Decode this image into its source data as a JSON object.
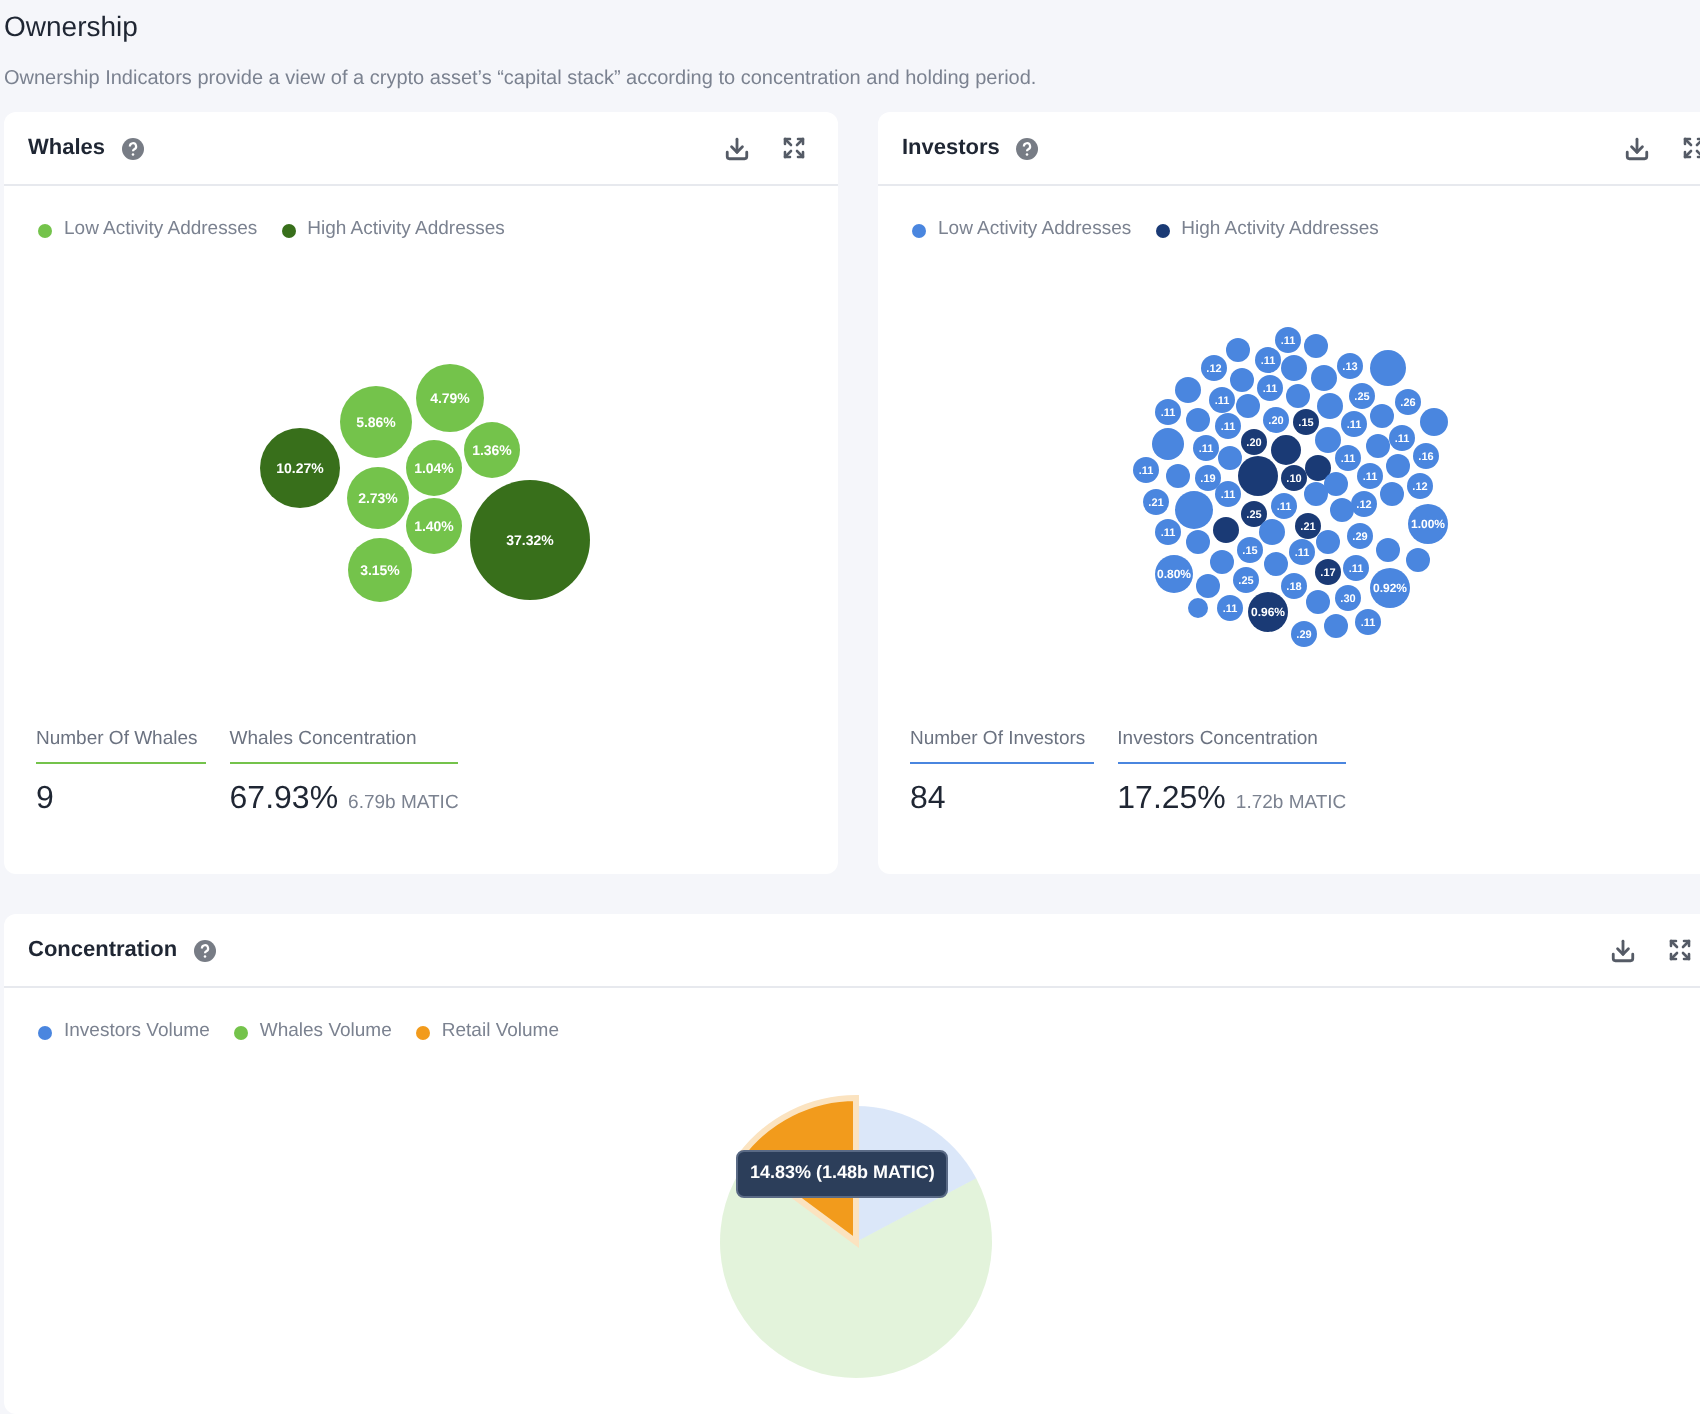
{
  "page": {
    "title": "Ownership",
    "description": "Ownership Indicators provide a view of a crypto asset’s “capital stack” according to concentration and holding period."
  },
  "panels": [
    {
      "title": "Whales",
      "legend": [
        {
          "label": "Low Activity Addresses",
          "color": "#74c34b"
        },
        {
          "label": "High Activity Addresses",
          "color": "#386f1b"
        }
      ],
      "bubbles": [
        {
          "label": "10.27%",
          "high_activity": true
        },
        {
          "label": "5.86%",
          "high_activity": false
        },
        {
          "label": "4.79%",
          "high_activity": false
        },
        {
          "label": "1.04%",
          "high_activity": false
        },
        {
          "label": "1.36%",
          "high_activity": false
        },
        {
          "label": "2.73%",
          "high_activity": false
        },
        {
          "label": "1.40%",
          "high_activity": false
        },
        {
          "label": "3.15%",
          "high_activity": false
        },
        {
          "label": "37.32%",
          "high_activity": true
        }
      ],
      "stats": [
        {
          "label": "Number Of Whales",
          "value": "9"
        },
        {
          "label": "Whales Concentration",
          "value": "67.93%",
          "sub": "6.79b MATIC"
        }
      ]
    },
    {
      "title": "Investors",
      "legend": [
        {
          "label": "Low Activity Addresses",
          "color": "#4a86df"
        },
        {
          "label": "High Activity Addresses",
          "color": "#1a3a75"
        }
      ],
      "bubbles": [
        {
          "label": ".11",
          "high_activity": false
        },
        {
          "label": ".12",
          "high_activity": false
        },
        {
          "label": ".11",
          "high_activity": false
        },
        {
          "label": ".13",
          "high_activity": false
        },
        {
          "label": ".11",
          "high_activity": false
        },
        {
          "label": ".11",
          "high_activity": false
        },
        {
          "label": ".25",
          "high_activity": false
        },
        {
          "label": ".26",
          "high_activity": false
        },
        {
          "label": ".11",
          "high_activity": false
        },
        {
          "label": ".20",
          "high_activity": false
        },
        {
          "label": ".15",
          "high_activity": true
        },
        {
          "label": ".11",
          "high_activity": false
        },
        {
          "label": ".11",
          "high_activity": false
        },
        {
          "label": ".20",
          "high_activity": true
        },
        {
          "label": ".11",
          "high_activity": false
        },
        {
          "label": ".11",
          "high_activity": false
        },
        {
          "label": ".11",
          "high_activity": false
        },
        {
          "label": ".16",
          "high_activity": false
        },
        {
          "label": ".11",
          "high_activity": false
        },
        {
          "label": ".19",
          "high_activity": false
        },
        {
          "label": ".10",
          "high_activity": true
        },
        {
          "label": ".11",
          "high_activity": false
        },
        {
          "label": ".12",
          "high_activity": false
        },
        {
          "label": ".21",
          "high_activity": false
        },
        {
          "label": ".11",
          "high_activity": false
        },
        {
          "label": ".25",
          "high_activity": true
        },
        {
          "label": ".11",
          "high_activity": false
        },
        {
          "label": ".12",
          "high_activity": false
        },
        {
          "label": ".21",
          "high_activity": true
        },
        {
          "label": ".11",
          "high_activity": false
        },
        {
          "label": ".29",
          "high_activity": false
        },
        {
          "label": "1.00%",
          "high_activity": false
        },
        {
          "label": ".15",
          "high_activity": false
        },
        {
          "label": ".11",
          "high_activity": false
        },
        {
          "label": ".11",
          "high_activity": false
        },
        {
          "label": "0.80%",
          "high_activity": false
        },
        {
          "label": ".17",
          "high_activity": true
        },
        {
          "label": ".25",
          "high_activity": false
        },
        {
          "label": ".18",
          "high_activity": false
        },
        {
          "label": ".30",
          "high_activity": false
        },
        {
          "label": "0.92%",
          "high_activity": false
        },
        {
          "label": ".11",
          "high_activity": false
        },
        {
          "label": "0.96%",
          "high_activity": true
        },
        {
          "label": ".11",
          "high_activity": false
        },
        {
          "label": ".29",
          "high_activity": false
        },
        {
          "high_activity": false
        },
        {
          "high_activity": false
        },
        {
          "high_activity": false
        },
        {
          "high_activity": false
        },
        {
          "high_activity": false
        },
        {
          "high_activity": false
        },
        {
          "high_activity": false
        },
        {
          "high_activity": false
        },
        {
          "high_activity": false
        },
        {
          "high_activity": false
        },
        {
          "high_activity": false
        },
        {
          "high_activity": false
        },
        {
          "high_activity": false
        },
        {
          "high_activity": false
        },
        {
          "high_activity": true
        },
        {
          "high_activity": false
        },
        {
          "high_activity": false
        },
        {
          "high_activity": false
        },
        {
          "high_activity": true
        },
        {
          "high_activity": true
        },
        {
          "high_activity": false
        },
        {
          "high_activity": false
        },
        {
          "high_activity": false
        },
        {
          "high_activity": false
        },
        {
          "high_activity": false
        },
        {
          "high_activity": false
        },
        {
          "high_activity": false
        },
        {
          "high_activity": true
        },
        {
          "high_activity": false
        },
        {
          "high_activity": false
        },
        {
          "high_activity": false
        },
        {
          "high_activity": false
        },
        {
          "high_activity": false
        },
        {
          "high_activity": false
        },
        {
          "high_activity": false
        },
        {
          "high_activity": false
        },
        {
          "high_activity": false
        },
        {
          "high_activity": false
        },
        {
          "high_activity": false
        }
      ],
      "stats": [
        {
          "label": "Number Of Investors",
          "value": "84"
        },
        {
          "label": "Investors Concentration",
          "value": "17.25%",
          "sub": "1.72b MATIC"
        }
      ]
    }
  ],
  "concentration": {
    "title": "Concentration",
    "legend": [
      {
        "color": "#4a86df"
      },
      {
        "color": "#74c34b"
      },
      {
        "color": "#f29b1c"
      }
    ],
    "tooltip": "14.83% (1.48b MATIC)",
    "highlighted_slices": [
      false,
      false,
      true
    ],
    "chart_data": {
      "type": "pie",
      "categories": [
        "Investors Volume",
        "Whales Volume",
        "Retail Volume"
      ],
      "series": [
        {
          "values": [
            17.25,
            67.93,
            14.83
          ]
        }
      ]
    }
  }
}
